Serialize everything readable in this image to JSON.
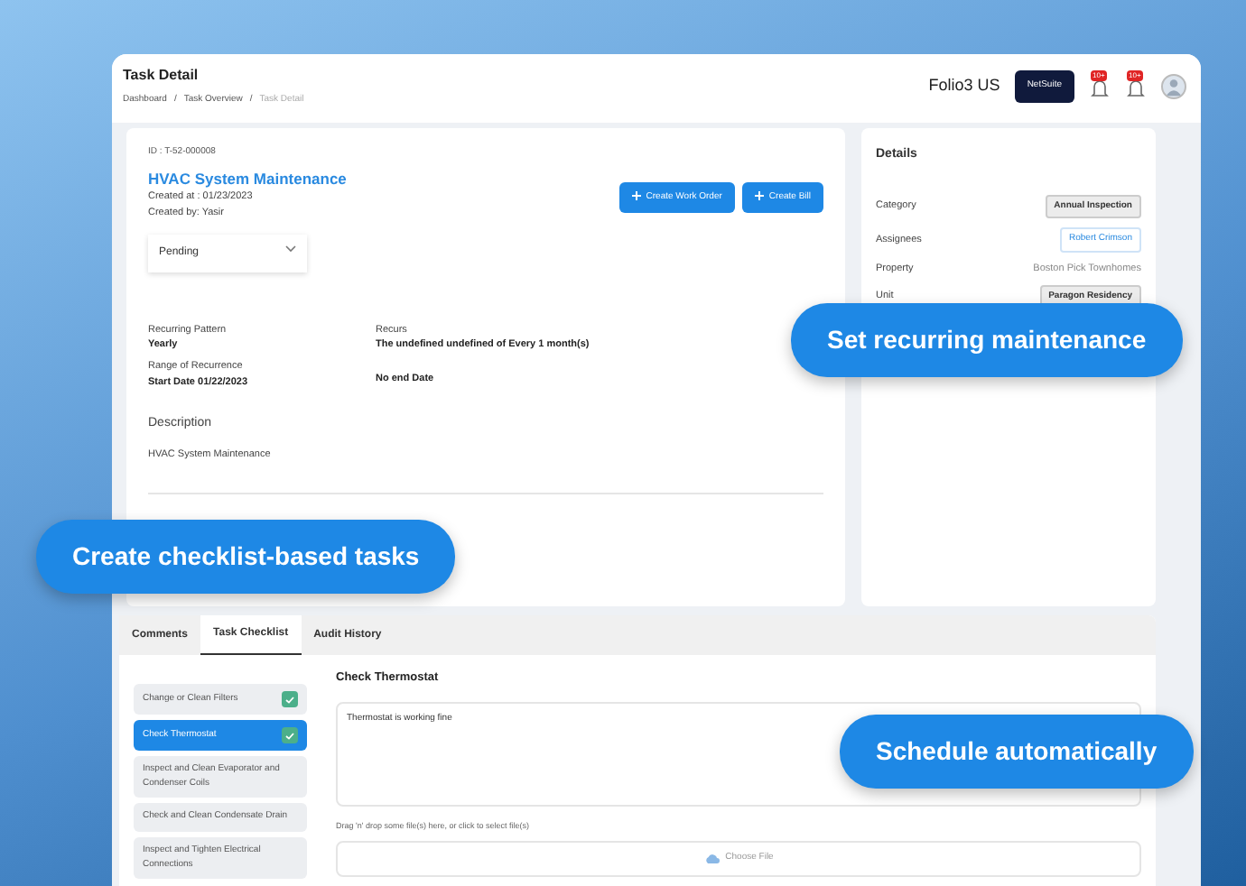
{
  "header": {
    "title": "Task Detail",
    "breadcrumb_separator": "/",
    "breadcrumb": [
      {
        "label": "Dashboard",
        "current": false
      },
      {
        "label": "Task Overview",
        "current": false
      },
      {
        "label": "Task Detail",
        "current": true
      }
    ],
    "company": "Folio3 US",
    "erp_button": "NetSuite",
    "notifications": [
      "10+",
      "10+"
    ]
  },
  "task": {
    "id": "ID : T-52-000008",
    "title": "HVAC System Maintenance",
    "created_at": "Created at : 01/23/2023",
    "created_by": "Created by: Yasir",
    "status": "Pending",
    "actions": [
      "Create Work Order",
      "Create Bill"
    ],
    "recurrence": [
      {
        "label": "Recurring Pattern",
        "value": "Yearly"
      },
      {
        "label": "Recurs",
        "value": "The undefined undefined of Every 1 month(s)"
      },
      {
        "label": "Range of Recurrence",
        "value": "Start Date 01/22/2023"
      },
      {
        "value": "No end Date"
      }
    ],
    "description_heading": "Description",
    "description": "HVAC System Maintenance"
  },
  "details": {
    "title": "Details",
    "rows": [
      {
        "label": "Category",
        "value": "Annual Inspection",
        "kind": "chip"
      },
      {
        "label": "Assignees",
        "value": "Robert Crimson",
        "kind": "person"
      },
      {
        "label": "Property",
        "value": "Boston Pick Townhomes",
        "kind": "plain"
      },
      {
        "label": "Unit",
        "value": "Paragon Residency",
        "kind": "chip"
      }
    ]
  },
  "tabs": [
    {
      "label": "Comments",
      "selected": false
    },
    {
      "label": "Task Checklist",
      "selected": true
    },
    {
      "label": "Audit History",
      "selected": false
    }
  ],
  "checklist": [
    {
      "label": "Change or Clean Filters",
      "done": true,
      "selected": false
    },
    {
      "label": "Check Thermostat",
      "done": true,
      "selected": true
    },
    {
      "label": "Inspect and Clean Evaporator and Condenser Coils",
      "done": false,
      "selected": false
    },
    {
      "label": "Check and Clean Condensate Drain",
      "done": false,
      "selected": false
    },
    {
      "label": "Inspect and Tighten Electrical Connections",
      "done": false,
      "selected": false
    }
  ],
  "item_detail": {
    "heading": "Check Thermostat",
    "note": "Thermostat is working fine",
    "drop_hint": "Drag 'n' drop some file(s) here, or click to select file(s)",
    "choose_file": "Choose File"
  },
  "callouts": [
    "Set recurring maintenance",
    "Create checklist-based tasks",
    "Schedule automatically"
  ]
}
